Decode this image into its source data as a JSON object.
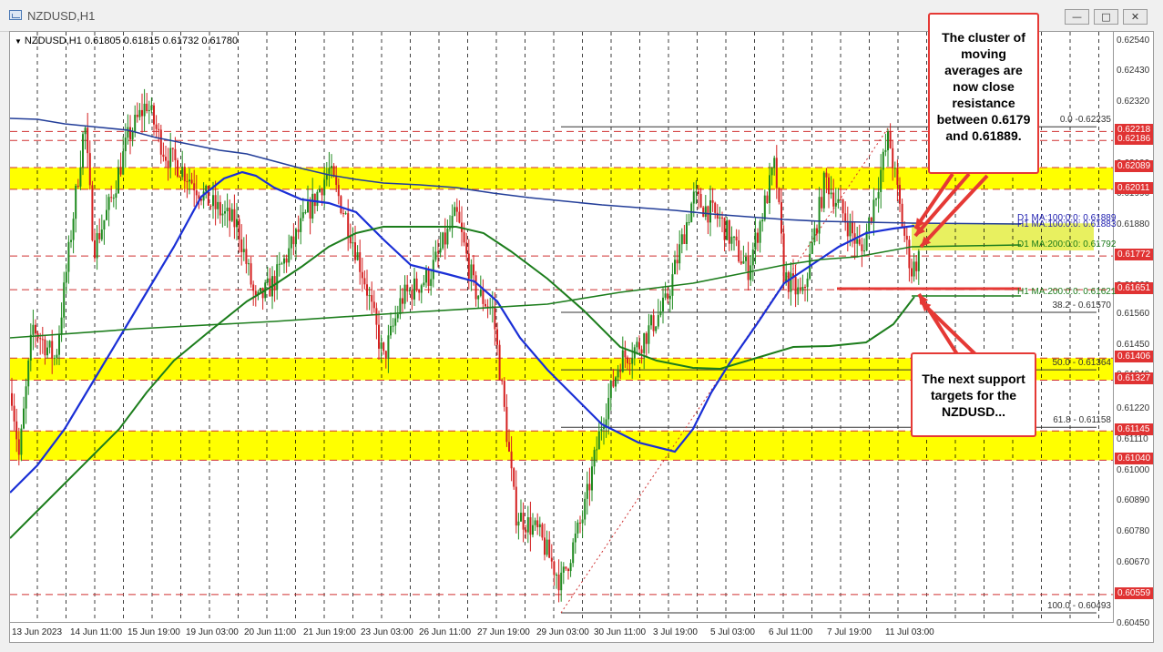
{
  "window": {
    "title": "NZDUSD,H1",
    "buttons": {
      "minimize": "—",
      "maximize": "□",
      "close": "✕"
    }
  },
  "chart_data": {
    "type": "candlestick",
    "symbol_info": "NZDUSD,H1  0.61805 0.61815 0.61732 0.61780",
    "ylim": [
      0.60454,
      0.62575
    ],
    "price_ticks": [
      "0.62540",
      "0.62430",
      "0.62320",
      "0.62210",
      "0.62100",
      "0.61990",
      "0.61880",
      "0.61770",
      "0.61660",
      "0.61560",
      "0.61450",
      "0.61340",
      "0.61220",
      "0.61110",
      "0.61000",
      "0.60890",
      "0.60780",
      "0.60670",
      "0.60560",
      "0.60450"
    ],
    "time_ticks": [
      "13 Jun 2023",
      "14 Jun 11:00",
      "15 Jun 19:00",
      "19 Jun 03:00",
      "20 Jun 11:00",
      "21 Jun 19:00",
      "23 Jun 03:00",
      "26 Jun 11:00",
      "27 Jun 19:00",
      "29 Jun 03:00",
      "30 Jun 11:00",
      "3 Jul 19:00",
      "5 Jul 03:00",
      "6 Jul 11:00",
      "7 Jul 19:00",
      "11 Jul 03:00"
    ],
    "price_tags": [
      {
        "price": 0.62218,
        "label": "0.62218"
      },
      {
        "price": 0.62186,
        "label": "0.62186"
      },
      {
        "price": 0.62089,
        "label": "0.62089"
      },
      {
        "price": 0.62011,
        "label": "0.62011"
      },
      {
        "price": 0.61772,
        "label": "0.61772"
      },
      {
        "price": 0.61651,
        "label": "0.61651"
      },
      {
        "price": 0.61406,
        "label": "0.61406"
      },
      {
        "price": 0.61327,
        "label": "0.61327"
      },
      {
        "price": 0.61145,
        "label": "0.61145"
      },
      {
        "price": 0.6104,
        "label": "0.61040"
      },
      {
        "price": 0.60559,
        "label": "0.60559"
      }
    ],
    "yellow_zones": [
      [
        0.62011,
        0.62089
      ],
      [
        0.61327,
        0.61406
      ],
      [
        0.6104,
        0.61145
      ]
    ],
    "fib_levels": [
      {
        "price": 0.62235,
        "label": "0.0 -0.62235"
      },
      {
        "price": 0.6157,
        "label": "38.2 - 0.61570"
      },
      {
        "price": 0.61364,
        "label": "50.0 - 0.61364"
      },
      {
        "price": 0.61158,
        "label": "61.8 - 0.61158"
      },
      {
        "price": 0.60493,
        "label": "100.0 - 0.60493"
      }
    ],
    "ma_labels": [
      {
        "text": "D1 MA:100:0:0: 0.61889",
        "color": "#2020b0"
      },
      {
        "text": "H1 MA:100:0:0: 0.61883",
        "color": "#2020b0"
      },
      {
        "text": "D1 MA:200:0:0: 0.61792",
        "color": "#1a7a1a"
      },
      {
        "text": "H1 MA:200:0:0: 0.61621",
        "color": "#1a7a1a"
      }
    ],
    "colors": {
      "bull": "#1f8a1f",
      "bear": "#d42020",
      "ma_blue": "#1a2fd6",
      "ma_green": "#1c7d1c",
      "ma_dark_blue": "#233e99",
      "zone": "#ffff00",
      "zone_hl": "#e8f060",
      "annot": "#e53935"
    }
  },
  "callouts": {
    "resistance": "The cluster of moving averages are now close resistance between 0.6179 and 0.61889.",
    "support": "The next support targets for the NZDUSD..."
  }
}
